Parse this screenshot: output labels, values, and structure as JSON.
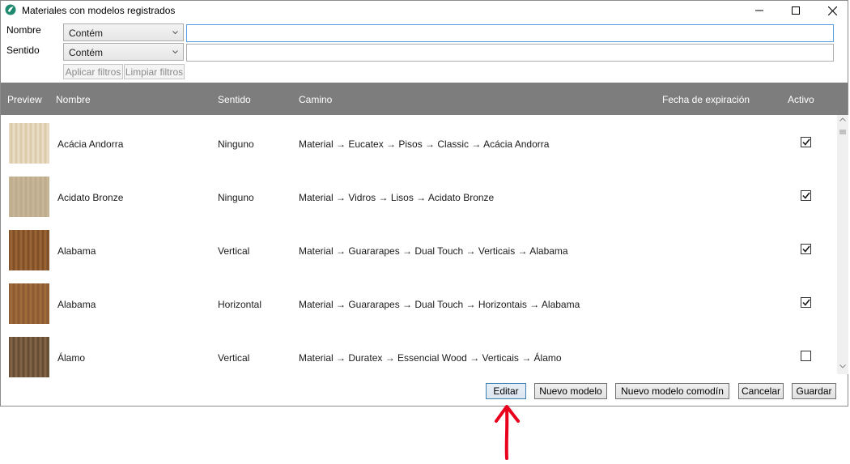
{
  "window": {
    "title": "Materiales con modelos registrados",
    "controls": [
      "minimize-icon",
      "maximize-icon",
      "close-icon"
    ]
  },
  "filters": {
    "nombre_label": "Nombre",
    "sentido_label": "Sentido",
    "nombre_mode": "Contém",
    "sentido_mode": "Contém",
    "nombre_value": "",
    "sentido_value": "",
    "apply_label": "Aplicar filtros",
    "clear_label": "Limpiar filtros"
  },
  "grid": {
    "columns": {
      "preview": "Preview",
      "nombre": "Nombre",
      "sentido": "Sentido",
      "camino": "Camino",
      "fecha": "Fecha de expiración",
      "activo": "Activo"
    },
    "rows": [
      {
        "nombre": "Acácia Andorra",
        "sentido": "Ninguno",
        "camino": "Material → Eucatex → Pisos → Classic → Acácia Andorra",
        "fecha": "",
        "activo": true,
        "swatch_from": "#ece1cb",
        "swatch_to": "#d9c7a5"
      },
      {
        "nombre": "Acidato Bronze",
        "sentido": "Ninguno",
        "camino": "Material → Vidros → Lisos → Acidato Bronze",
        "fecha": "",
        "activo": true,
        "swatch_from": "#c9b89a",
        "swatch_to": "#bca98a"
      },
      {
        "nombre": "Alabama",
        "sentido": "Vertical",
        "camino": "Material → Guararapes → Dual Touch → Verticais → Alabama",
        "fecha": "",
        "activo": true,
        "swatch_from": "#7a4a23",
        "swatch_to": "#a06a3a"
      },
      {
        "nombre": "Alabama",
        "sentido": "Horizontal",
        "camino": "Material → Guararapes → Dual Touch → Horizontais → Alabama",
        "fecha": "",
        "activo": true,
        "swatch_from": "#8a5530",
        "swatch_to": "#a3703f"
      },
      {
        "nombre": "Álamo",
        "sentido": "Vertical",
        "camino": "Material → Duratex → Essencial Wood → Verticais → Álamo",
        "fecha": "",
        "activo": false,
        "swatch_from": "#5e4630",
        "swatch_to": "#8a6a4a"
      }
    ]
  },
  "actions": {
    "editar": "Editar",
    "nuevo_modelo": "Nuevo modelo",
    "nuevo_comodin": "Nuevo modelo comodín",
    "cancelar": "Cancelar",
    "guardar": "Guardar"
  },
  "colors": {
    "header_bg": "#7d7d7d",
    "focus_border": "#569de5",
    "annotation_arrow": "#e8001c"
  }
}
